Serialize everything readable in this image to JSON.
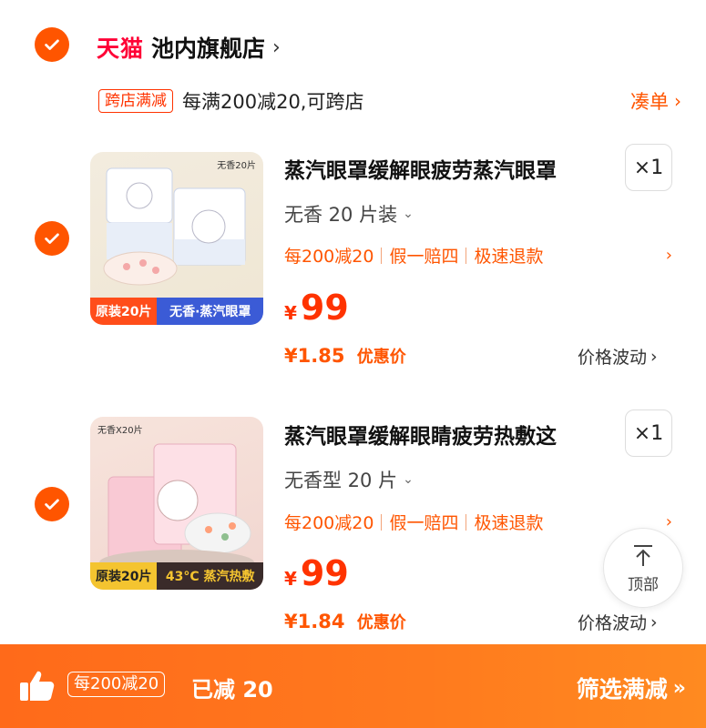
{
  "store": {
    "brand": "天猫",
    "name": "池内旗舰店",
    "chevron": "›"
  },
  "promo": {
    "tag": "跨店满减",
    "text": "每满200减20,可跨店",
    "action": "凑单",
    "action_arrow": "›"
  },
  "products": [
    {
      "title": "蒸汽眼罩缓解眼疲劳蒸汽眼罩",
      "quantity": "×1",
      "spec": "无香 20 片装",
      "benefits": [
        "每200减20",
        "假一赔四",
        "极速退款"
      ],
      "price_currency": "¥",
      "price": "99",
      "deal_price": "¥1.85",
      "deal_label": "优惠价",
      "price_wave": "价格波动",
      "thumb_corner": "无香20片",
      "thumb_band_left": "原装20片",
      "thumb_band_right": "无香·蒸汽眼罩"
    },
    {
      "title": "蒸汽眼罩缓解眼睛疲劳热敷这",
      "quantity": "×1",
      "spec": "无香型 20 片",
      "benefits": [
        "每200减20",
        "假一赔四",
        "极速退款"
      ],
      "price_currency": "¥",
      "price": "99",
      "deal_price": "¥1.84",
      "deal_label": "优惠价",
      "price_wave": "价格波动",
      "thumb_corner": "无香X20片",
      "thumb_band_left": "原装20片",
      "thumb_band_right": "43°C 蒸汽热敷"
    }
  ],
  "back_to_top": {
    "label": "顶部"
  },
  "bottom_bar": {
    "tag": "每200减20",
    "reduced": "已减 20",
    "filter": "筛选满减",
    "filter_icon": "»"
  },
  "colors": {
    "accent": "#ff5500",
    "tmall": "#ff0036",
    "price": "#ff3300"
  },
  "icons": [
    "check-icon",
    "chevron-right-icon",
    "chevron-down-icon",
    "thumbs-up-icon",
    "arrow-up-icon"
  ]
}
